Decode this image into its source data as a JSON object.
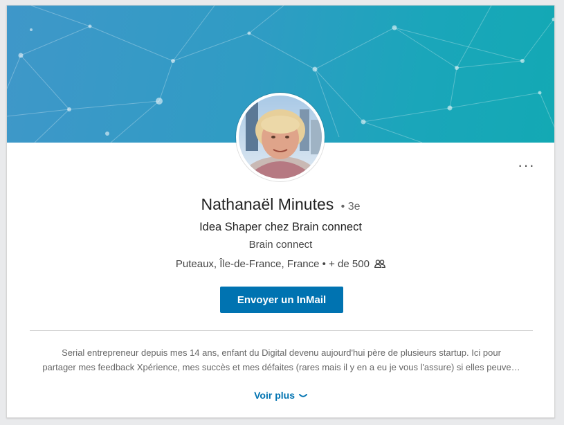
{
  "profile": {
    "name": "Nathanaël Minutes",
    "degree": "• 3e",
    "headline": "Idea Shaper chez Brain connect",
    "company": "Brain connect",
    "location": "Puteaux, Île-de-France, France",
    "separator": "•",
    "connections": "+ de 500"
  },
  "actions": {
    "inmail_label": "Envoyer un InMail",
    "more_label": "···"
  },
  "summary": {
    "line1": "Serial entrepreneur depuis mes 14 ans, enfant du Digital devenu aujourd'hui père de plusieurs startup. Ici pour",
    "line2": "partager mes feedback Xpérience, mes succès et mes défaites (rares mais il y en a eu je vous l'assure) si elles peuve…",
    "see_more": "Voir plus"
  },
  "icons": {
    "connections": "people-icon",
    "see_more": "chevron-down-icon",
    "more": "ellipsis-icon"
  },
  "colors": {
    "accent": "#0073b1",
    "banner": "#2f9cc4"
  }
}
